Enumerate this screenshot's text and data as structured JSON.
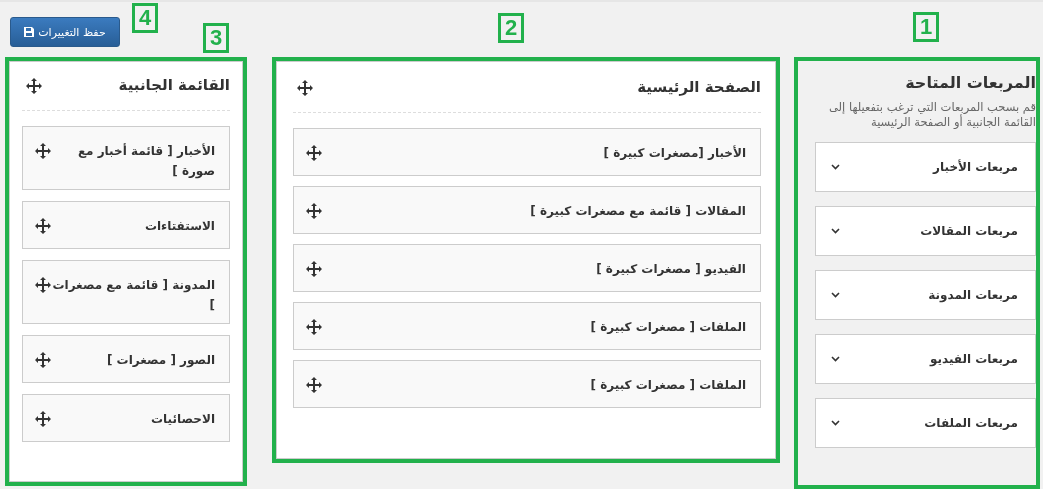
{
  "save_button": {
    "marker": "4",
    "label": "حفظ التغييرات"
  },
  "sidebar": {
    "marker": "3",
    "title": "القائمة الجانبية",
    "blocks": [
      {
        "label": "الأخبار [ قائمة أخبار مع صورة ]"
      },
      {
        "label": "الاستفتاءات"
      },
      {
        "label": "المدونة [ قائمة مع مصغرات ]"
      },
      {
        "label": "الصور [ مصغرات ]"
      },
      {
        "label": "الاحصائيات"
      }
    ]
  },
  "main_page": {
    "marker": "2",
    "title": "الصفحة الرئيسية",
    "blocks": [
      {
        "label": "الأخبار [مصغرات كبيرة ]"
      },
      {
        "label": "المقالات [ قائمة مع مصغرات كبيرة ]"
      },
      {
        "label": "الفيديو [ مصغرات كبيرة ]"
      },
      {
        "label": "الملفات [ مصغرات كبيرة ]"
      },
      {
        "label": "الملفات [ مصغرات كبيرة ]"
      }
    ]
  },
  "available_blocks": {
    "marker": "1",
    "title": "المربعات المتاحة",
    "description": "قم بسحب المربعات التي ترغب بتفعيلها إلى القائمة الجانبية أو الصفحة الرئيسية",
    "items": [
      {
        "label": "مربعات الأخبار",
        "expanded": false
      },
      {
        "label": "مربعات المقالات",
        "expanded": false
      },
      {
        "label": "مربعات المدونة",
        "expanded": false
      },
      {
        "label": "مربعات الفيديو",
        "expanded": false
      },
      {
        "label": "مربعات الملفات",
        "expanded": false
      }
    ]
  }
}
